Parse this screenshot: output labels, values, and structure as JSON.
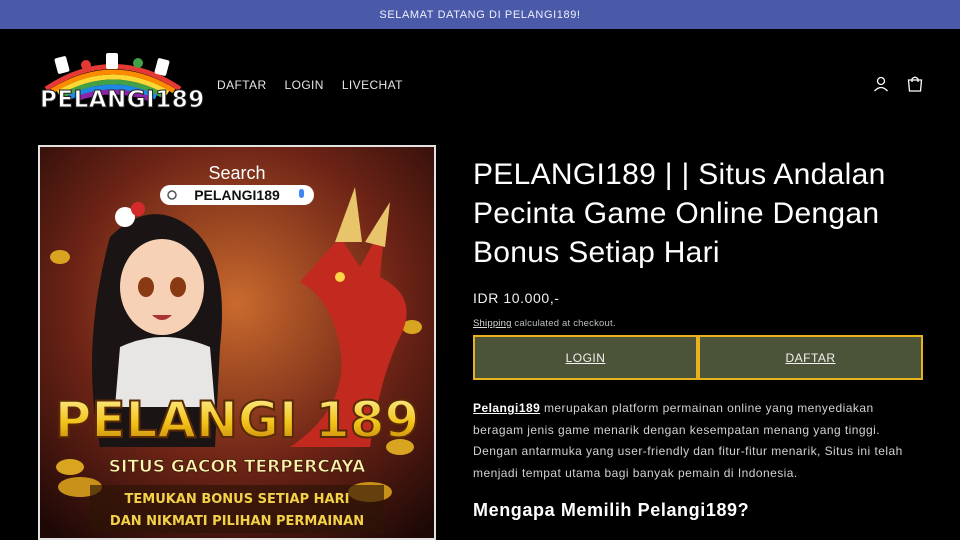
{
  "announcement": "SELAMAT DATANG DI PELANGI189!",
  "logo": {
    "text": "PELANGI189"
  },
  "nav": {
    "items": [
      "DAFTAR",
      "LOGIN",
      "LIVECHAT"
    ]
  },
  "header_icons": [
    "user-icon",
    "cart-icon"
  ],
  "hero": {
    "search_label": "Search",
    "search_query": "PELANGI189",
    "brand": "PELANGI 189",
    "tagline": "SITUS GACOR TERPERCAYA",
    "line1": "TEMUKAN BONUS SETIAP HARI",
    "line2": "DAN NIKMATI PILIHAN PERMAINAN"
  },
  "product": {
    "title": "PELANGI189 | | Situs Andalan Pecinta Game Online Dengan Bonus Setiap Hari",
    "price": "IDR 10.000,-",
    "shipping_link": "Shipping",
    "shipping_text": " calculated at checkout.",
    "buttons": {
      "login": "LOGIN",
      "daftar": "DAFTAR"
    },
    "desc_brand": "Pelangi189",
    "desc_text": " merupakan platform permainan online yang menyediakan beragam jenis game menarik dengan kesempatan menang yang tinggi. Dengan antarmuka yang user-friendly dan fitur-fitur menarik, Situs ini telah menjadi tempat utama bagi banyak pemain di Indonesia.",
    "subheading": "Mengapa Memilih Pelangi189?"
  },
  "colors": {
    "announce_bg": "#4a5aa8",
    "button_bg": "#4b5438",
    "button_border": "#e8b21e"
  }
}
